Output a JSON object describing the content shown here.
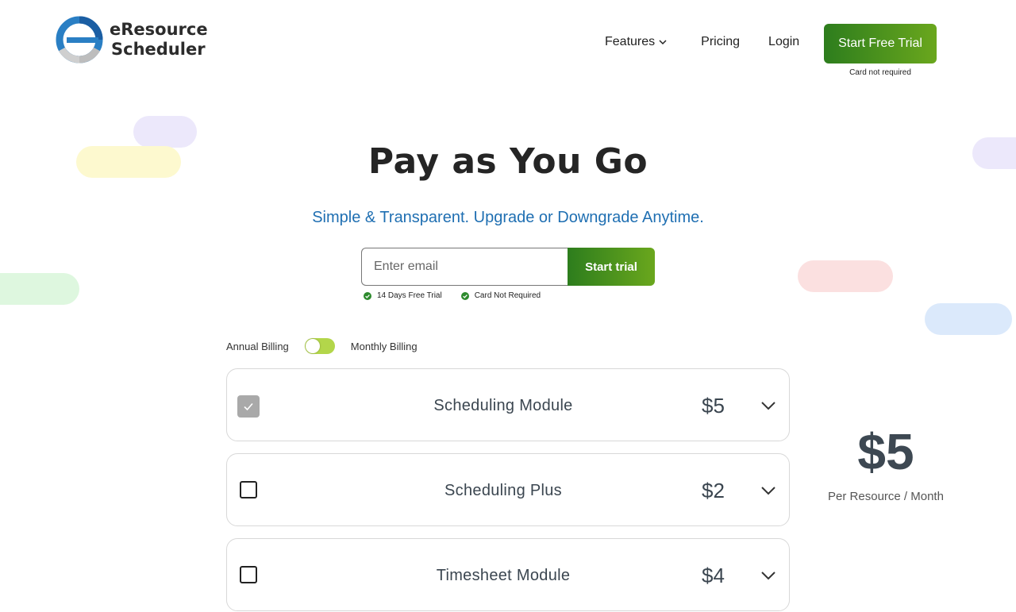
{
  "logo": {
    "line1": "eResource",
    "line2": "Scheduler"
  },
  "nav": {
    "features": "Features",
    "pricing": "Pricing",
    "login": "Login"
  },
  "cta": {
    "label": "Start Free Trial",
    "note": "Card not required"
  },
  "hero": {
    "title": "Pay as You Go",
    "subtitle": "Simple & Transparent. Upgrade or Downgrade Anytime."
  },
  "signup": {
    "placeholder": "Enter email",
    "button": "Start trial",
    "badges": [
      "14 Days Free Trial",
      "Card Not Required"
    ]
  },
  "billing": {
    "annual": "Annual Billing",
    "monthly": "Monthly Billing",
    "selected": "Monthly Billing"
  },
  "modules": [
    {
      "name": "Scheduling Module",
      "price": "$5",
      "checked": true
    },
    {
      "name": "Scheduling Plus",
      "price": "$2",
      "checked": false
    },
    {
      "name": "Timesheet Module",
      "price": "$4",
      "checked": false
    }
  ],
  "summary": {
    "price": "$5",
    "unit": "Per Resource / Month"
  },
  "colors": {
    "accent_green": "#2d7d1d",
    "accent_blue": "#1f6fb2",
    "toggle": "#b3d64a"
  }
}
